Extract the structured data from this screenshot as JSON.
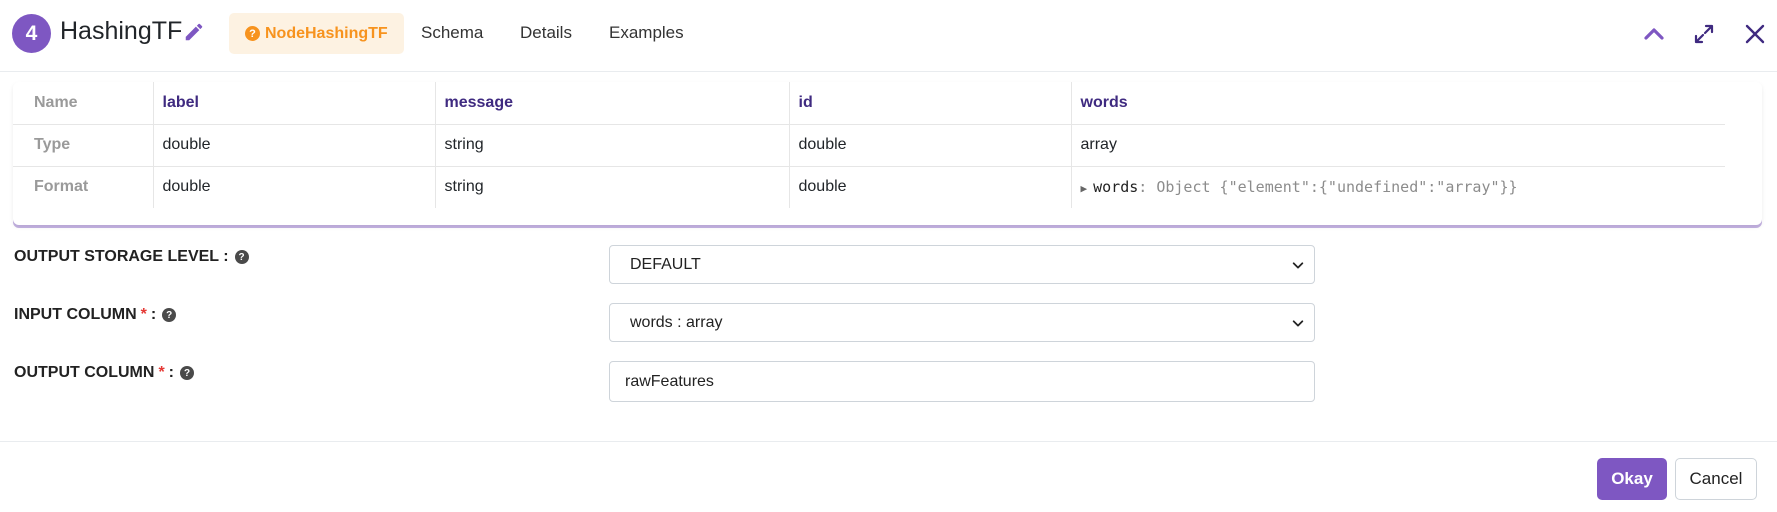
{
  "header": {
    "step_number": "4",
    "title": "HashingTF",
    "tabs": [
      {
        "label": "NodeHashingTF",
        "active": true
      },
      {
        "label": "Schema"
      },
      {
        "label": "Details"
      },
      {
        "label": "Examples"
      }
    ],
    "icons": [
      "chevron-up-icon",
      "expand-icon",
      "close-icon"
    ]
  },
  "schema_table": {
    "row_labels": [
      "Name",
      "Type",
      "Format"
    ],
    "columns": [
      {
        "name": "label",
        "type": "double",
        "format": "double"
      },
      {
        "name": "message",
        "type": "string",
        "format": "string"
      },
      {
        "name": "id",
        "type": "double",
        "format": "double"
      },
      {
        "name": "words",
        "type": "array",
        "format_key": "words",
        "format_rest": ": Object {\"element\":{\"undefined\":\"array\"}}"
      }
    ]
  },
  "form": {
    "storage_level": {
      "label": "OUTPUT STORAGE LEVEL :",
      "value": "DEFAULT"
    },
    "input_column": {
      "label": "INPUT COLUMN",
      "required_mark": "*",
      "colon": ":",
      "value": "words : array"
    },
    "output_column": {
      "label": "OUTPUT COLUMN",
      "required_mark": "*",
      "colon": ":",
      "value": "rawFeatures"
    }
  },
  "footer": {
    "okay_label": "Okay",
    "cancel_label": "Cancel"
  },
  "colors": {
    "accent": "#7e57c2",
    "active_tab_text": "#f7931e",
    "active_tab_bg": "#fdf2e2",
    "required": "#e53935"
  }
}
